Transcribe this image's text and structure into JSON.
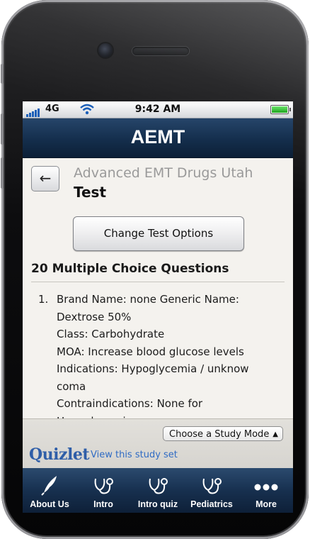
{
  "status_bar": {
    "carrier": "4G",
    "time": "9:42 AM"
  },
  "nav": {
    "title": "AEMT"
  },
  "content": {
    "back_label": "←",
    "set_title": "Advanced EMT Drugs Utah",
    "test_label": "Test",
    "change_button": "Change Test Options",
    "questions_heading": "20 Multiple Choice Questions",
    "question_number": "1.",
    "question_lines": [
      "Brand Name: none Generic Name:",
      "Dextrose 50%",
      "Class: Carbohydrate",
      "MOA: Increase blood glucose levels",
      "Indications: Hypoglycemia / unknow",
      "coma",
      "Contraindications: None for",
      "Hypoglycemia"
    ]
  },
  "bottom": {
    "study_mode": "Choose a Study Mode",
    "logo": "Quizlet",
    "view_link": "View this study set"
  },
  "tabs": [
    {
      "label": "About Us",
      "icon": "quill-icon"
    },
    {
      "label": "Intro",
      "icon": "stethoscope-icon"
    },
    {
      "label": "Intro quiz",
      "icon": "stethoscope-icon"
    },
    {
      "label": "Pediatrics",
      "icon": "stethoscope-icon"
    },
    {
      "label": "More",
      "icon": "more-dots-icon"
    }
  ],
  "colors": {
    "nav_bar": "#142e4c",
    "link": "#2f6bc4",
    "logo": "#2f5ea8",
    "screen_bg": "#f4f2ee"
  }
}
